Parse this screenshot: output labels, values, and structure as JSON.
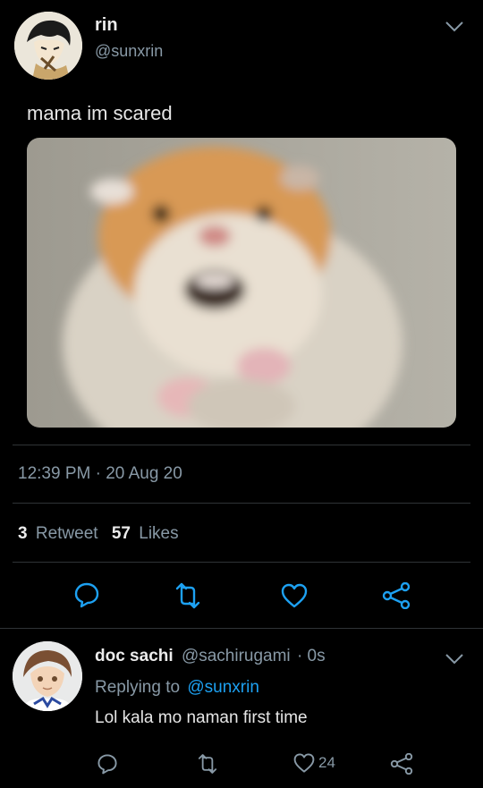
{
  "tweet": {
    "display_name": "rin",
    "handle": "@sunxrin",
    "text": "mama im scared",
    "timestamp": "12:39 PM · 20 Aug 20",
    "retweet_count": "3",
    "retweet_label": "Retweet",
    "likes_count": "57",
    "likes_label": "Likes"
  },
  "reply": {
    "display_name": "doc sachi",
    "handle": "@sachirugami",
    "time": "· 0s",
    "replying_to_label": "Replying to",
    "replying_to_handle": "@sunxrin",
    "text": "Lol kala mo naman first time",
    "like_count": "24"
  },
  "icons": [
    "chevron-down-icon",
    "reply-icon",
    "retweet-icon",
    "heart-icon",
    "share-icon"
  ],
  "colors": {
    "background": "#000000",
    "link": "#1da1f2",
    "muted": "#8899a6",
    "divider": "#2f3336"
  }
}
